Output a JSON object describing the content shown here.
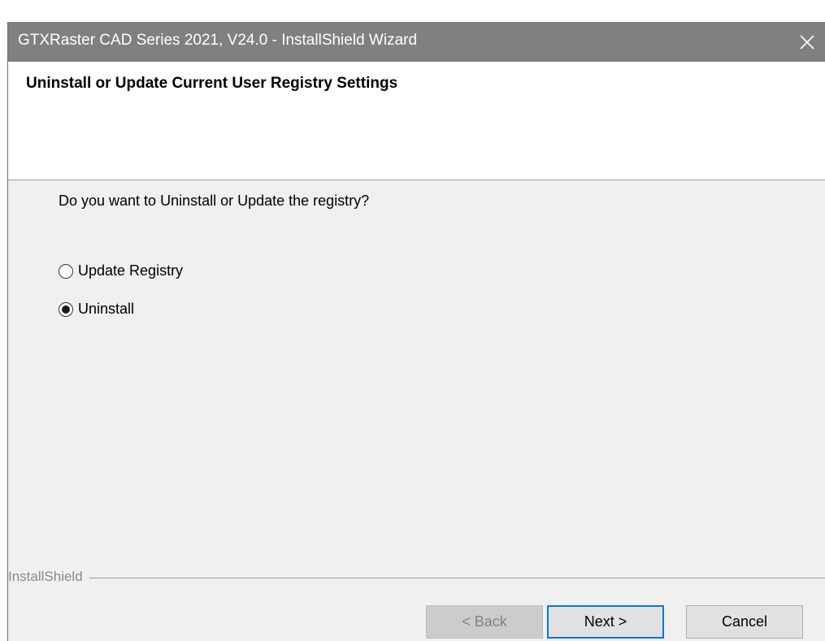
{
  "window": {
    "title": "GTXRaster CAD Series 2021, V24.0 - InstallShield Wizard",
    "close_glyph": "✕"
  },
  "header": {
    "title": "Uninstall or Update Current User Registry Settings"
  },
  "body": {
    "question": "Do you want to Uninstall or Update the registry?",
    "options": [
      {
        "label": "Update Registry",
        "selected": false
      },
      {
        "label": "Uninstall",
        "selected": true
      }
    ]
  },
  "footer": {
    "brand": "InstallShield",
    "back_label": "< Back",
    "next_label": "Next >",
    "cancel_label": "Cancel"
  },
  "colors": {
    "titlebar": "#808080",
    "focus_border": "#0078d7",
    "dialog_bg": "#f0f0f0"
  }
}
